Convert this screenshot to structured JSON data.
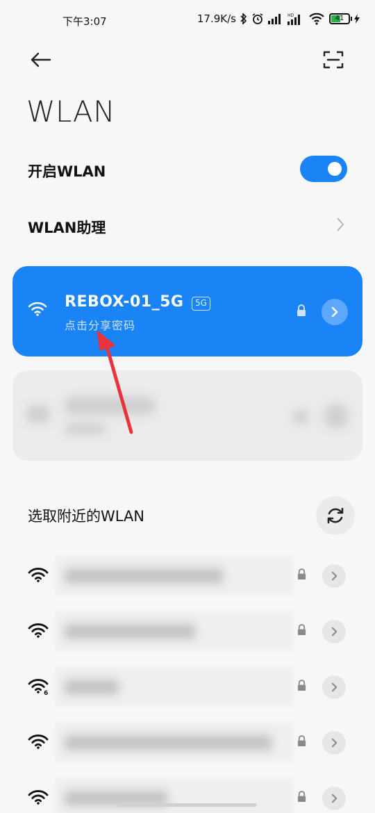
{
  "status_bar": {
    "time": "下午3:07",
    "net_speed": "17.9K/s",
    "battery": "41"
  },
  "page": {
    "title": "WLAN"
  },
  "settings": {
    "wlan_toggle_label": "开启WLAN",
    "wlan_toggle_on": true,
    "assistant_label": "WLAN助理"
  },
  "connected": {
    "ssid": "REBOX-01_5G",
    "band_badge": "5G",
    "subtitle": "点击分享密码"
  },
  "nearby": {
    "section_title": "选取附近的WLAN"
  },
  "colors": {
    "accent": "#1a83f6",
    "annotation": "#e8333c"
  },
  "icons": {
    "back": "arrow-left-icon",
    "scan": "scan-icon",
    "wifi": "wifi-icon",
    "lock": "lock-icon",
    "chevron": "chevron-right-icon",
    "refresh": "refresh-icon"
  }
}
